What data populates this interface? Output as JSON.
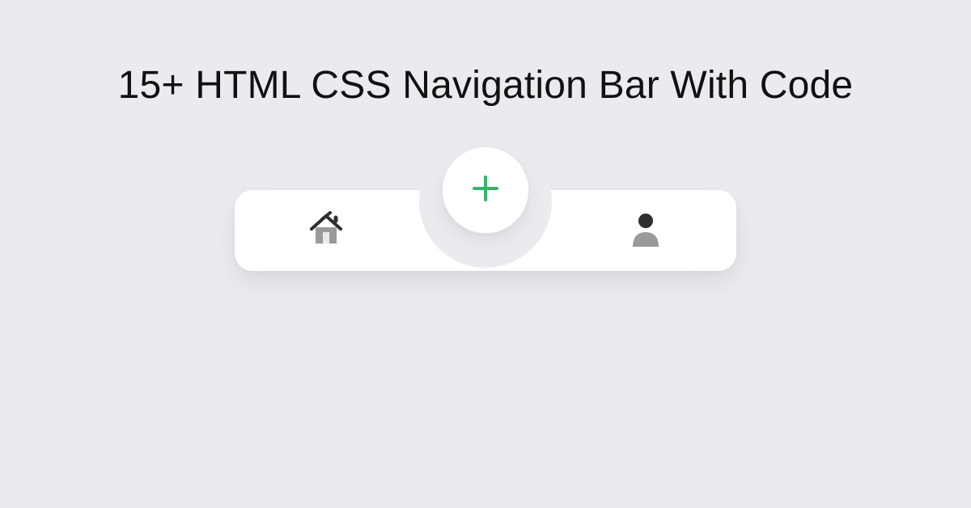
{
  "title": "15+ HTML CSS Navigation Bar With Code",
  "nav": {
    "home": "home",
    "add": "add",
    "profile": "profile"
  },
  "colors": {
    "accent": "#35b369",
    "iconDark": "#2f2f2f",
    "iconMuted": "#9a9a9a"
  }
}
